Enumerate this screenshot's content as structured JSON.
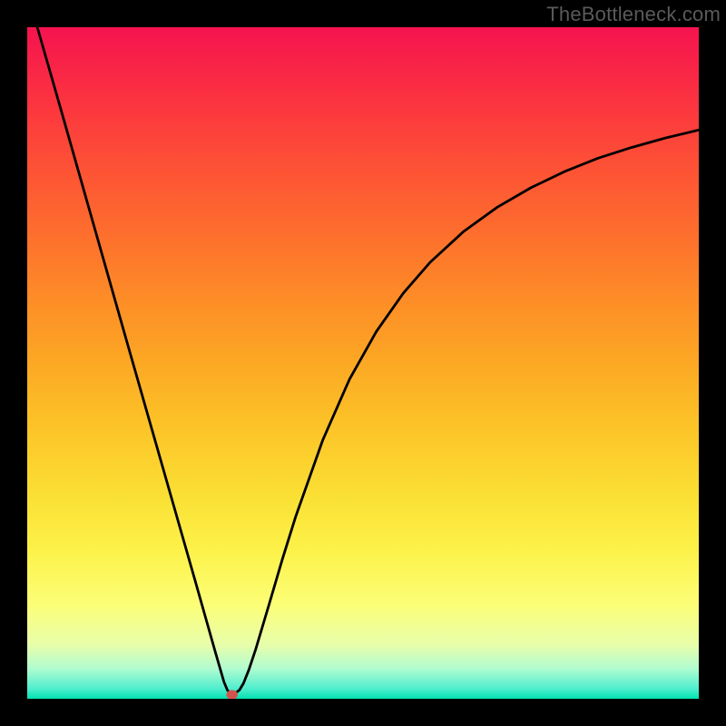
{
  "watermark": "TheBottleneck.com",
  "colors": {
    "frame": "#000000",
    "curve": "#000000",
    "marker": "#d0544b",
    "gradient_stops": [
      {
        "offset": 0.0,
        "color": "#f5134f"
      },
      {
        "offset": 0.1,
        "color": "#fb3041"
      },
      {
        "offset": 0.2,
        "color": "#fd4f36"
      },
      {
        "offset": 0.3,
        "color": "#fd6c2e"
      },
      {
        "offset": 0.4,
        "color": "#fd8b27"
      },
      {
        "offset": 0.5,
        "color": "#fca824"
      },
      {
        "offset": 0.6,
        "color": "#fcc528"
      },
      {
        "offset": 0.7,
        "color": "#fbe034"
      },
      {
        "offset": 0.78,
        "color": "#fcf24a"
      },
      {
        "offset": 0.86,
        "color": "#fcfe77"
      },
      {
        "offset": 0.92,
        "color": "#e7feab"
      },
      {
        "offset": 0.955,
        "color": "#b1fcd0"
      },
      {
        "offset": 0.985,
        "color": "#4feece"
      },
      {
        "offset": 1.0,
        "color": "#00e3b1"
      }
    ]
  },
  "chart_data": {
    "type": "line",
    "title": "",
    "xlabel": "",
    "ylabel": "",
    "xlim": [
      0,
      100
    ],
    "ylim": [
      0,
      100
    ],
    "min_marker": {
      "x": 30.5,
      "y": 0.6
    },
    "series": [
      {
        "name": "curve",
        "points": [
          {
            "x": 1.5,
            "y": 100.0
          },
          {
            "x": 5.0,
            "y": 87.8
          },
          {
            "x": 10.0,
            "y": 70.2
          },
          {
            "x": 15.0,
            "y": 52.6
          },
          {
            "x": 20.0,
            "y": 35.1
          },
          {
            "x": 25.0,
            "y": 17.6
          },
          {
            "x": 28.0,
            "y": 7.0
          },
          {
            "x": 29.3,
            "y": 2.5
          },
          {
            "x": 29.8,
            "y": 1.3
          },
          {
            "x": 30.2,
            "y": 0.85
          },
          {
            "x": 31.0,
            "y": 0.85
          },
          {
            "x": 31.6,
            "y": 1.3
          },
          {
            "x": 32.2,
            "y": 2.3
          },
          {
            "x": 33.0,
            "y": 4.3
          },
          {
            "x": 34.0,
            "y": 7.3
          },
          {
            "x": 36.0,
            "y": 14.0
          },
          {
            "x": 38.0,
            "y": 20.8
          },
          {
            "x": 40.0,
            "y": 27.2
          },
          {
            "x": 44.0,
            "y": 38.5
          },
          {
            "x": 48.0,
            "y": 47.6
          },
          {
            "x": 52.0,
            "y": 54.7
          },
          {
            "x": 56.0,
            "y": 60.4
          },
          {
            "x": 60.0,
            "y": 65.0
          },
          {
            "x": 65.0,
            "y": 69.6
          },
          {
            "x": 70.0,
            "y": 73.2
          },
          {
            "x": 75.0,
            "y": 76.1
          },
          {
            "x": 80.0,
            "y": 78.5
          },
          {
            "x": 85.0,
            "y": 80.5
          },
          {
            "x": 90.0,
            "y": 82.1
          },
          {
            "x": 95.0,
            "y": 83.5
          },
          {
            "x": 100.0,
            "y": 84.7
          }
        ]
      }
    ]
  }
}
